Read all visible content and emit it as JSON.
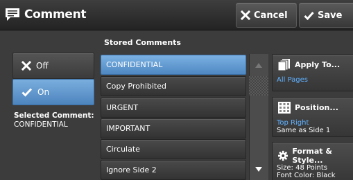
{
  "header": {
    "title": "Comment",
    "cancel_label": "Cancel",
    "save_label": "Save"
  },
  "toggle": {
    "off_label": "Off",
    "on_label": "On",
    "selected": "On"
  },
  "selection": {
    "label": "Selected Comment:",
    "value": "CONFIDENTIAL"
  },
  "stored": {
    "heading": "Stored Comments",
    "items": [
      {
        "label": "CONFIDENTIAL",
        "selected": true
      },
      {
        "label": "Copy Prohibited",
        "selected": false
      },
      {
        "label": "URGENT",
        "selected": false
      },
      {
        "label": "IMPORTANT",
        "selected": false
      },
      {
        "label": "Circulate",
        "selected": false
      },
      {
        "label": "Ignore Side 2",
        "selected": false
      }
    ]
  },
  "apply_to": {
    "label": "Apply To...",
    "value": "All Pages"
  },
  "position": {
    "label": "Position...",
    "value": "Top Right",
    "detail": "Same as Side 1"
  },
  "format": {
    "label": "Format & Style...",
    "size": "Size: 48 Points",
    "color": "Font Color: Black"
  },
  "colors": {
    "accent": "#5a92cc",
    "value_text": "#5fb1ff",
    "background": "#3c3c3c"
  },
  "icons": [
    "comment-icon",
    "close-icon",
    "check-icon",
    "pages-icon",
    "grid-icon",
    "gear-icon",
    "arrow-up-icon",
    "arrow-down-icon"
  ]
}
